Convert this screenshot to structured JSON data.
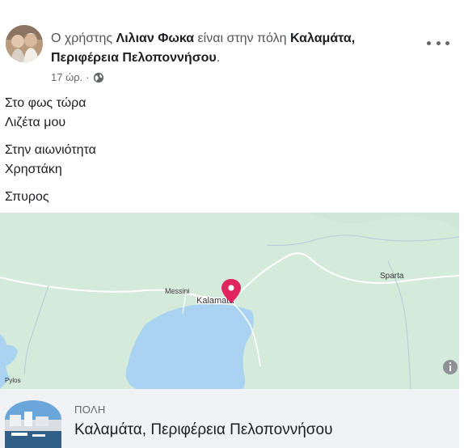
{
  "post": {
    "header": {
      "prefix": "Ο χρήστης ",
      "author": "Λιλιαν Φωκα",
      "middle": " είναι στην πόλη ",
      "location_line1": "Καλαμάτα,",
      "location_line2": "Περιφέρεια Πελοποννήσου",
      "suffix": "."
    },
    "time": "17 ώρ.",
    "separator": "·",
    "privacy_icon": "globe-icon",
    "more_icon": "more-options-icon",
    "body": {
      "p1": [
        "Στο φως τώρα",
        "Λιζέτα μου"
      ],
      "p2": [
        "Στην αιωνιότητα",
        "Χρηστάκη"
      ],
      "p3": [
        "Σπυρος"
      ]
    }
  },
  "map": {
    "labels": {
      "kalamata": "Kalamata",
      "messini": "Messini",
      "sparta": "Sparta",
      "pylos": "Pylos"
    },
    "pin_color": "#e0245e",
    "info_icon": "info-icon"
  },
  "place": {
    "kicker": "ΠΟΛΗ",
    "name": "Καλαμάτα, Περιφέρεια Πελοποννήσου"
  }
}
